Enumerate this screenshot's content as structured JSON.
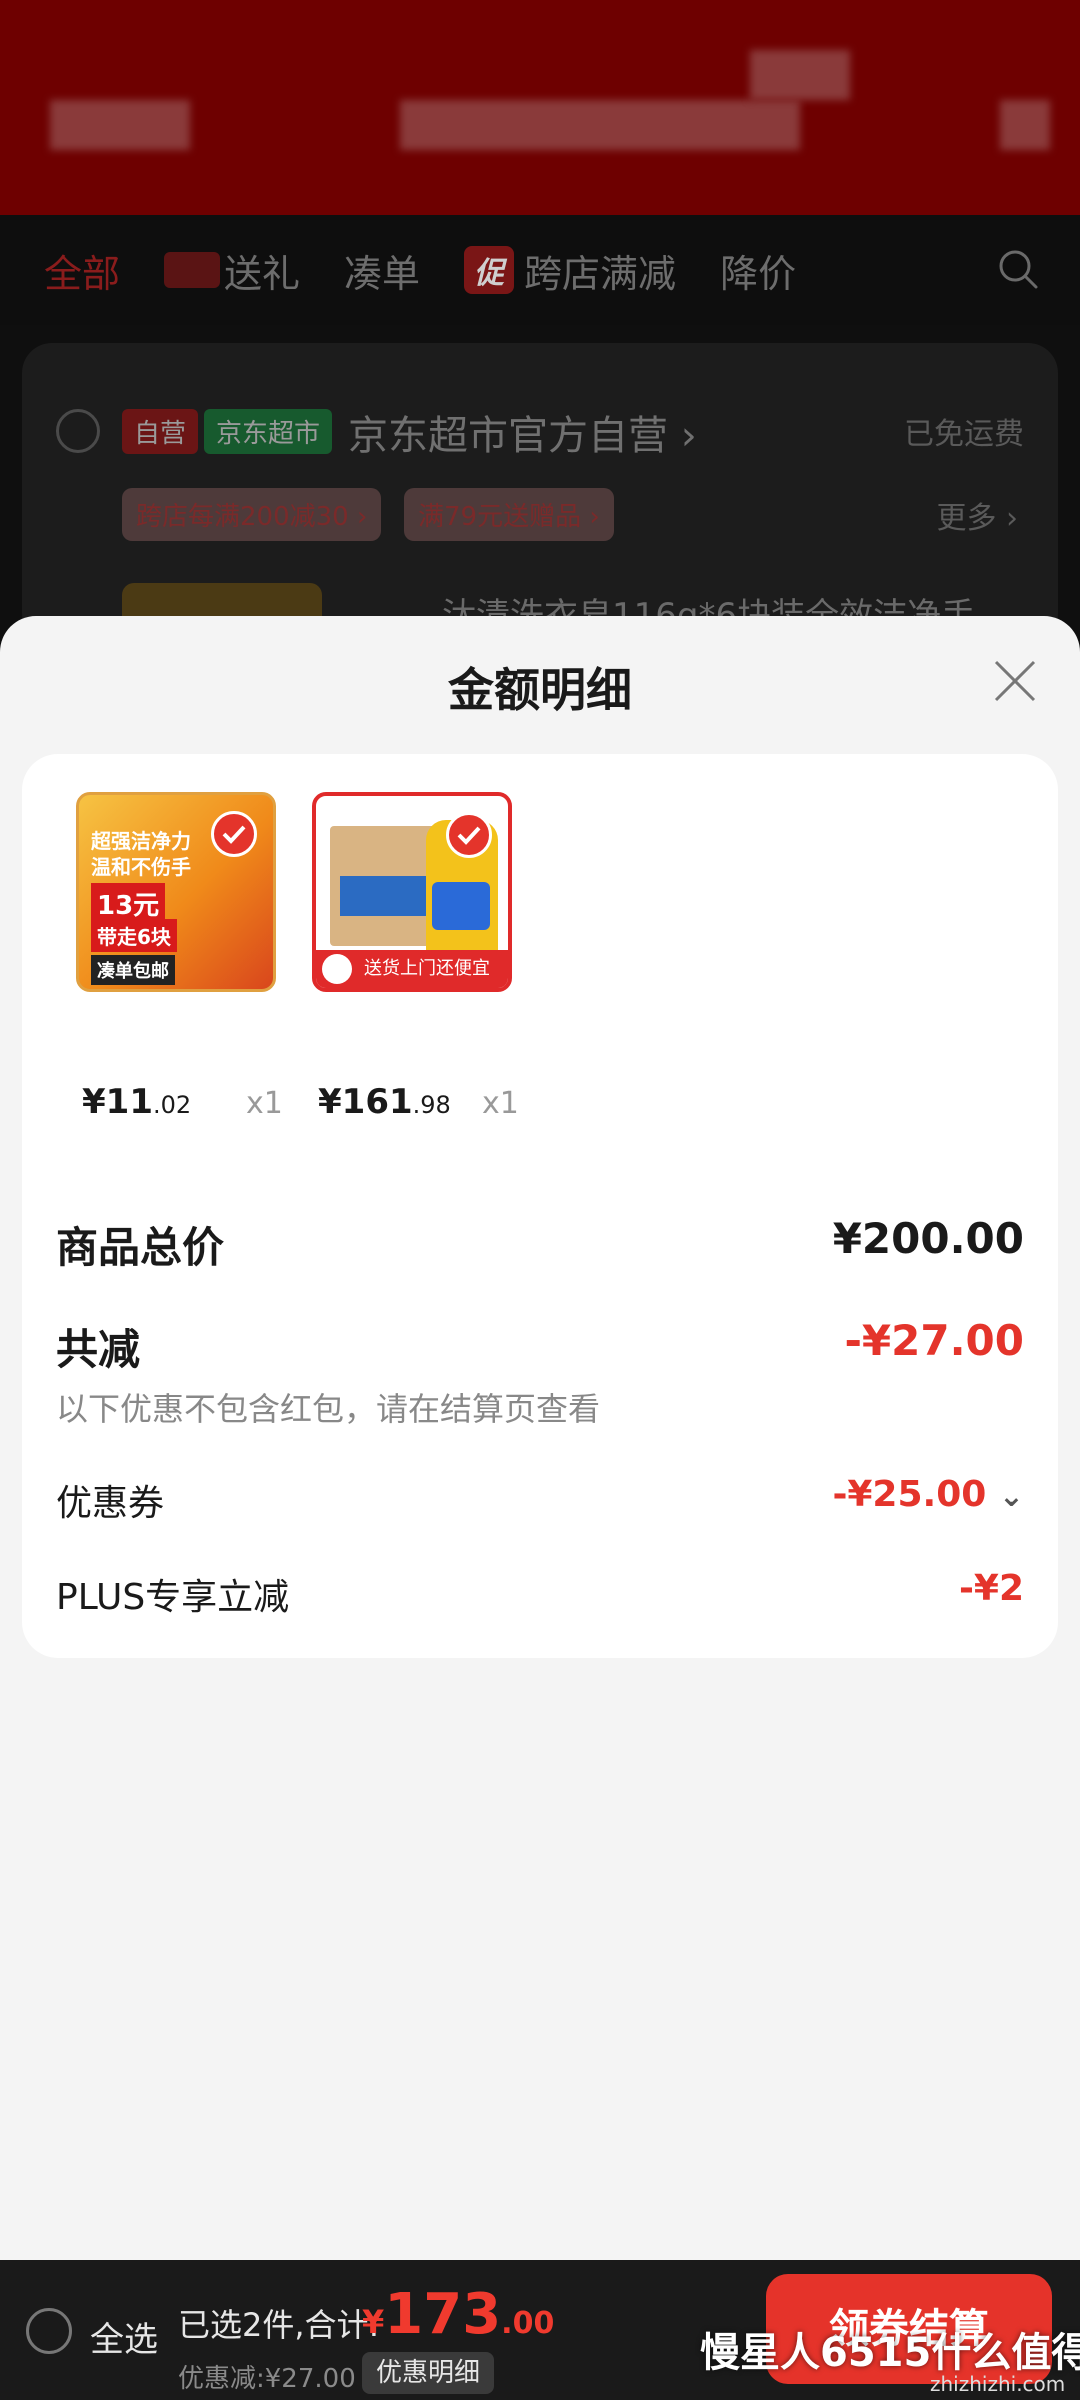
{
  "colors": {
    "accent_red": "#e4342b",
    "sheet_bg": "#f4f4f4",
    "card_bg": "#ffffff",
    "overlay_dark": "#0f0f0f"
  },
  "background": {
    "tabs": [
      {
        "label": "全部",
        "active": true
      },
      {
        "label": "送礼",
        "icon": "gift-box-icon"
      },
      {
        "label": "凑单"
      },
      {
        "label": "跨店满减",
        "badge": "促"
      },
      {
        "label": "降价"
      }
    ],
    "store": {
      "tag_self": "自营",
      "tag_market": "京东超市",
      "name": "京东超市官方自营",
      "chevron": "›",
      "free_shipping": "已免运费",
      "promo1": "跨店每满200减30 ›",
      "promo2": "满79元送赠品 ›",
      "more": "更多 ›",
      "product_title": "汰渍洗衣皂116g*6块装全效洁净手"
    }
  },
  "sheet": {
    "title": "金额明细",
    "items": [
      {
        "name": "soap",
        "img_lines": [
          "超强洁净力",
          "温和不伤手",
          "13元",
          "带走6块",
          "凑单包邮"
        ],
        "price_int": "¥11",
        "price_dec": ".02",
        "qty": "x1"
      },
      {
        "name": "oil",
        "img_strip": "送货上门还便宜",
        "price_int": "¥161",
        "price_dec": ".98",
        "qty": "x1"
      }
    ],
    "summary": {
      "total_label": "商品总价",
      "total_value": "¥200.00",
      "reduce_label": "共减",
      "reduce_value": "-¥27.00",
      "note": "以下优惠不包含红包，请在结算页查看",
      "coupon_label": "优惠券",
      "coupon_value": "-¥25.00",
      "coupon_chevron": "⌄",
      "plus_label": "PLUS专享立减",
      "plus_value": "-¥2"
    }
  },
  "bottom_bar": {
    "select_all": "全选",
    "selected": "已选2件,合计:",
    "yen": "¥",
    "amount_int": "173",
    "amount_dec": ".00",
    "discount": "优惠减:¥27.00",
    "detail_button": "优惠明细",
    "checkout": "领券结算",
    "watermark": "慢星人6515什么值得买",
    "watermark_url": "zhizhizhi.com"
  }
}
